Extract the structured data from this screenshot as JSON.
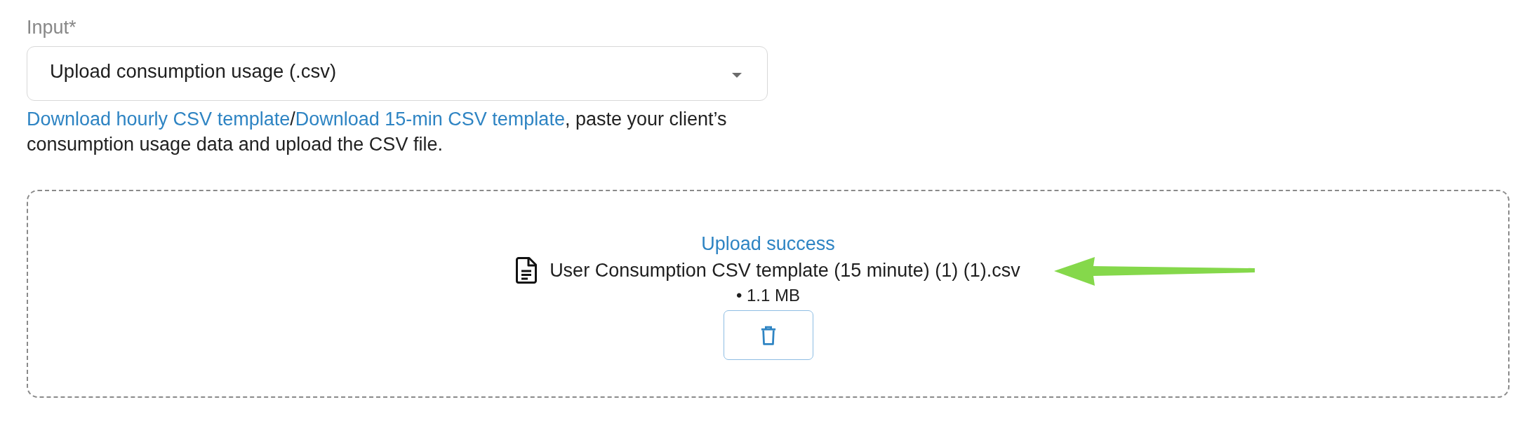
{
  "field": {
    "label": "Input*",
    "value": "Upload consumption usage (.csv)"
  },
  "help_text": {
    "parts": [
      {
        "kind": "link",
        "text": "Download hourly CSV template"
      },
      {
        "kind": "text",
        "text": "/"
      },
      {
        "kind": "link",
        "text": "Download 15-min CSV template"
      },
      {
        "kind": "text",
        "text": ", paste your client’s consumption usage data and upload the CSV file."
      }
    ]
  },
  "upload": {
    "status": "Upload success",
    "file_name": "User Consumption CSV template (15 minute) (1) (1).csv",
    "file_size": "• 1.1 MB"
  }
}
